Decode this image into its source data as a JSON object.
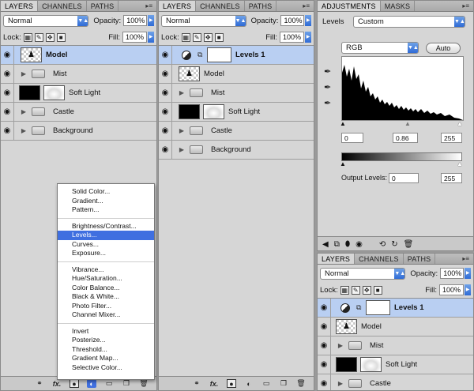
{
  "panel1": {
    "tabs": [
      "LAYERS",
      "CHANNELS",
      "PATHS"
    ],
    "blend_mode": "Normal",
    "opacity_label": "Opacity:",
    "opacity": "100%",
    "lock_label": "Lock:",
    "fill_label": "Fill:",
    "fill": "100%",
    "layers": [
      {
        "name": "Model",
        "kind": "model",
        "selected": true
      },
      {
        "name": "Mist",
        "kind": "folder"
      },
      {
        "name": "Soft Light",
        "kind": "mask"
      },
      {
        "name": "Castle",
        "kind": "folder"
      },
      {
        "name": "Background",
        "kind": "folder"
      }
    ],
    "bottom": {
      "fx": "fx."
    }
  },
  "menu": {
    "groups": [
      [
        "Solid Color...",
        "Gradient...",
        "Pattern..."
      ],
      [
        "Brightness/Contrast...",
        "Levels...",
        "Curves...",
        "Exposure..."
      ],
      [
        "Vibrance...",
        "Hue/Saturation...",
        "Color Balance...",
        "Black & White...",
        "Photo Filter...",
        "Channel Mixer..."
      ],
      [
        "Invert",
        "Posterize...",
        "Threshold...",
        "Gradient Map...",
        "Selective Color..."
      ]
    ],
    "highlighted": "Levels..."
  },
  "panel2": {
    "tabs": [
      "LAYERS",
      "CHANNELS",
      "PATHS"
    ],
    "blend_mode": "Normal",
    "opacity_label": "Opacity:",
    "opacity": "100%",
    "lock_label": "Lock:",
    "fill_label": "Fill:",
    "fill": "100%",
    "layers": [
      {
        "name": "Levels 1",
        "kind": "adjust",
        "selected": true
      },
      {
        "name": "Model",
        "kind": "model"
      },
      {
        "name": "Mist",
        "kind": "folder"
      },
      {
        "name": "Soft Light",
        "kind": "mask"
      },
      {
        "name": "Castle",
        "kind": "folder"
      },
      {
        "name": "Background",
        "kind": "folder"
      }
    ],
    "bottom": {
      "fx": "fx."
    }
  },
  "adjustments": {
    "tabs": [
      "ADJUSTMENTS",
      "MASKS"
    ],
    "title": "Levels",
    "preset": "Custom",
    "channel": "RGB",
    "auto_label": "Auto",
    "input_black": "0",
    "input_gamma": "0.86",
    "input_white": "255",
    "output_label": "Output Levels:",
    "output_black": "0",
    "output_white": "255"
  },
  "panel4": {
    "tabs": [
      "LAYERS",
      "CHANNELS",
      "PATHS"
    ],
    "blend_mode": "Normal",
    "opacity_label": "Opacity:",
    "opacity": "100%",
    "lock_label": "Lock:",
    "fill_label": "Fill:",
    "fill": "100%",
    "layers": [
      {
        "name": "Levels 1",
        "kind": "adjust",
        "selected": true
      },
      {
        "name": "Model",
        "kind": "model"
      },
      {
        "name": "Mist",
        "kind": "folder"
      },
      {
        "name": "Soft Light",
        "kind": "mask"
      },
      {
        "name": "Castle",
        "kind": "folder"
      }
    ]
  }
}
